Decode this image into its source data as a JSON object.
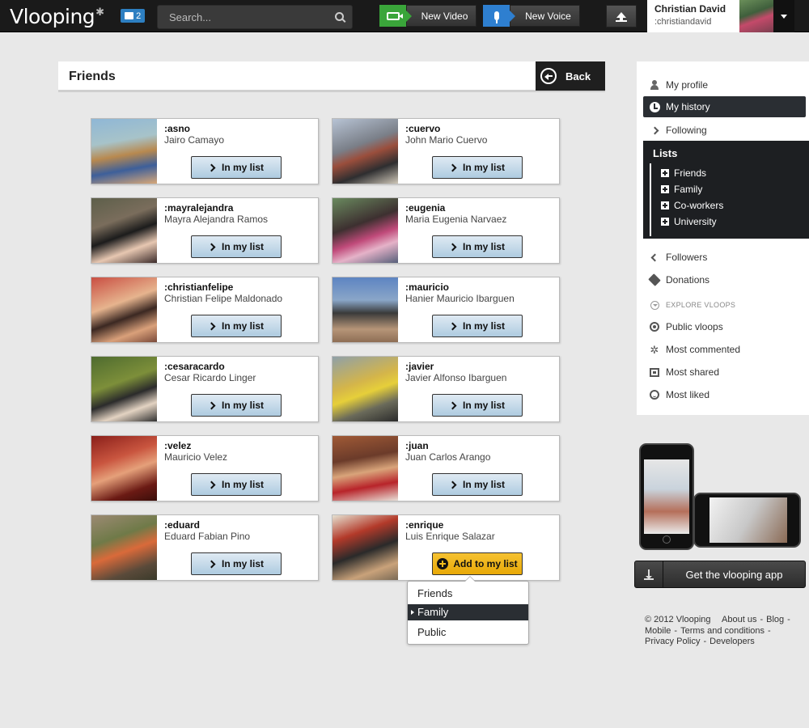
{
  "topbar": {
    "logo": "Vlooping",
    "messages_count": "2",
    "search_placeholder": "Search...",
    "new_video": "New Video",
    "new_voice": "New Voice",
    "user_name": "Christian David",
    "user_handle": ":christiandavid"
  },
  "header": {
    "title": "Friends",
    "back": "Back"
  },
  "friends": [
    {
      "handle": ":asno",
      "name": "Jairo Camayo",
      "button": "In my list"
    },
    {
      "handle": ":cuervo",
      "name": "John Mario Cuervo",
      "button": "In my list"
    },
    {
      "handle": ":mayralejandra",
      "name": "Mayra Alejandra Ramos",
      "button": "In my list"
    },
    {
      "handle": ":eugenia",
      "name": "Maria Eugenia Narvaez",
      "button": "In my list"
    },
    {
      "handle": ":christianfelipe",
      "name": "Christian Felipe Maldonado",
      "button": "In my list"
    },
    {
      "handle": ":mauricio",
      "name": "Hanier Mauricio Ibarguen",
      "button": "In my list"
    },
    {
      "handle": ":cesaracardo",
      "name": "Cesar Ricardo Linger",
      "button": "In my list"
    },
    {
      "handle": ":javier",
      "name": "Javier Alfonso Ibarguen",
      "button": "In my list"
    },
    {
      "handle": ":velez",
      "name": "Mauricio Velez",
      "button": "In my list"
    },
    {
      "handle": ":juan",
      "name": "Juan Carlos Arango",
      "button": "In my list"
    },
    {
      "handle": ":eduard",
      "name": "Eduard Fabian Pino",
      "button": "In my list"
    },
    {
      "handle": ":enrique",
      "name": "Luis Enrique Salazar",
      "button": "Add to my list"
    }
  ],
  "list_dropdown": {
    "options": [
      "Friends",
      "Family",
      "Public"
    ],
    "selected": "Family"
  },
  "sidebar": {
    "my_profile": "My profile",
    "my_history": "My history",
    "following": "Following",
    "lists_title": "Lists",
    "lists": [
      "Friends",
      "Family",
      "Co-workers",
      "University"
    ],
    "followers": "Followers",
    "donations": "Donations",
    "explore": "EXPLORE VLOOPS",
    "public_vloops": "Public vloops",
    "most_commented": "Most commented",
    "most_shared": "Most shared",
    "most_liked": "Most liked"
  },
  "promo": {
    "get_app": "Get the vlooping app"
  },
  "footer": {
    "copyright": "© 2012 Vlooping",
    "about": "About us",
    "blog": "Blog",
    "mobile": "Mobile",
    "terms": "Terms and conditions",
    "privacy": "Privacy Policy",
    "developers": "Developers"
  },
  "colors": {
    "topbar": "#1a1a1a",
    "accent_blue": "#aecbe0",
    "accent_yellow": "#f4bb1c",
    "dark_panel": "#1d1f22"
  }
}
